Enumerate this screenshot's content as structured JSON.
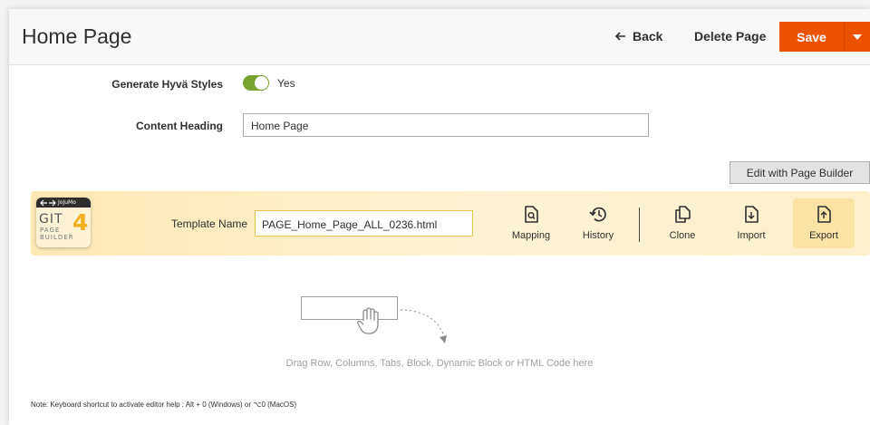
{
  "header": {
    "title": "Home Page",
    "back_label": "Back",
    "delete_label": "Delete Page",
    "save_label": "Save"
  },
  "form": {
    "hyva_label": "Generate Hyvä Styles",
    "hyva_value": "Yes",
    "hyva_enabled": true,
    "content_heading_label": "Content Heading",
    "content_heading_value": "Home Page",
    "edit_button_label": "Edit with Page Builder"
  },
  "gitbar": {
    "logo": {
      "brand": "JoJuMo",
      "git": "GIT",
      "four": "4",
      "page": "PAGE",
      "builder": "BUILDER"
    },
    "template_name_label": "Template Name",
    "template_name_value": "PAGE_Home_Page_ALL_0236.html",
    "actions": [
      {
        "label": "Mapping",
        "icon": "mapping-icon"
      },
      {
        "label": "History",
        "icon": "history-icon"
      },
      {
        "label": "Clone",
        "icon": "clone-icon"
      },
      {
        "label": "Import",
        "icon": "import-icon"
      },
      {
        "label": "Export",
        "icon": "export-icon"
      }
    ]
  },
  "stage": {
    "drop_text": "Drag Row, Columns, Tabs, Block, Dynamic Block or HTML Code here"
  },
  "note": "Note: Keyboard shortcut to activate editor help : Alt + 0 (Windows) or ⌥0 (MacOS)",
  "colors": {
    "accent": "#eb5202",
    "toggle_on": "#79a22e",
    "bar": "#fdf0cb",
    "logo_four": "#f2b01e"
  }
}
